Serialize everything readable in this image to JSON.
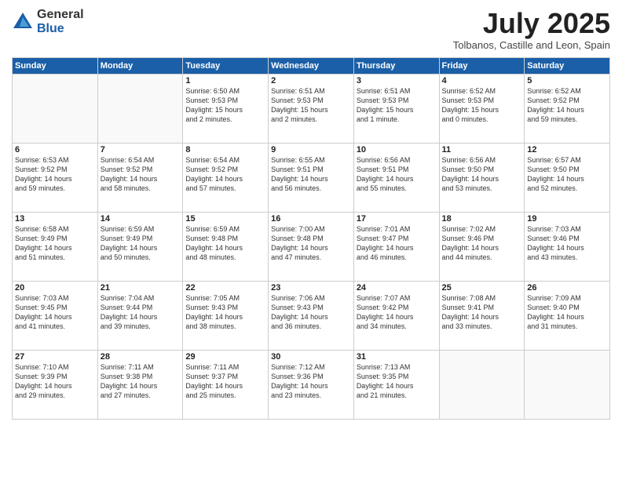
{
  "logo": {
    "general": "General",
    "blue": "Blue"
  },
  "title": "July 2025",
  "location": "Tolbanos, Castille and Leon, Spain",
  "weekdays": [
    "Sunday",
    "Monday",
    "Tuesday",
    "Wednesday",
    "Thursday",
    "Friday",
    "Saturday"
  ],
  "weeks": [
    [
      {
        "day": "",
        "info": ""
      },
      {
        "day": "",
        "info": ""
      },
      {
        "day": "1",
        "info": "Sunrise: 6:50 AM\nSunset: 9:53 PM\nDaylight: 15 hours\nand 2 minutes."
      },
      {
        "day": "2",
        "info": "Sunrise: 6:51 AM\nSunset: 9:53 PM\nDaylight: 15 hours\nand 2 minutes."
      },
      {
        "day": "3",
        "info": "Sunrise: 6:51 AM\nSunset: 9:53 PM\nDaylight: 15 hours\nand 1 minute."
      },
      {
        "day": "4",
        "info": "Sunrise: 6:52 AM\nSunset: 9:53 PM\nDaylight: 15 hours\nand 0 minutes."
      },
      {
        "day": "5",
        "info": "Sunrise: 6:52 AM\nSunset: 9:52 PM\nDaylight: 14 hours\nand 59 minutes."
      }
    ],
    [
      {
        "day": "6",
        "info": "Sunrise: 6:53 AM\nSunset: 9:52 PM\nDaylight: 14 hours\nand 59 minutes."
      },
      {
        "day": "7",
        "info": "Sunrise: 6:54 AM\nSunset: 9:52 PM\nDaylight: 14 hours\nand 58 minutes."
      },
      {
        "day": "8",
        "info": "Sunrise: 6:54 AM\nSunset: 9:52 PM\nDaylight: 14 hours\nand 57 minutes."
      },
      {
        "day": "9",
        "info": "Sunrise: 6:55 AM\nSunset: 9:51 PM\nDaylight: 14 hours\nand 56 minutes."
      },
      {
        "day": "10",
        "info": "Sunrise: 6:56 AM\nSunset: 9:51 PM\nDaylight: 14 hours\nand 55 minutes."
      },
      {
        "day": "11",
        "info": "Sunrise: 6:56 AM\nSunset: 9:50 PM\nDaylight: 14 hours\nand 53 minutes."
      },
      {
        "day": "12",
        "info": "Sunrise: 6:57 AM\nSunset: 9:50 PM\nDaylight: 14 hours\nand 52 minutes."
      }
    ],
    [
      {
        "day": "13",
        "info": "Sunrise: 6:58 AM\nSunset: 9:49 PM\nDaylight: 14 hours\nand 51 minutes."
      },
      {
        "day": "14",
        "info": "Sunrise: 6:59 AM\nSunset: 9:49 PM\nDaylight: 14 hours\nand 50 minutes."
      },
      {
        "day": "15",
        "info": "Sunrise: 6:59 AM\nSunset: 9:48 PM\nDaylight: 14 hours\nand 48 minutes."
      },
      {
        "day": "16",
        "info": "Sunrise: 7:00 AM\nSunset: 9:48 PM\nDaylight: 14 hours\nand 47 minutes."
      },
      {
        "day": "17",
        "info": "Sunrise: 7:01 AM\nSunset: 9:47 PM\nDaylight: 14 hours\nand 46 minutes."
      },
      {
        "day": "18",
        "info": "Sunrise: 7:02 AM\nSunset: 9:46 PM\nDaylight: 14 hours\nand 44 minutes."
      },
      {
        "day": "19",
        "info": "Sunrise: 7:03 AM\nSunset: 9:46 PM\nDaylight: 14 hours\nand 43 minutes."
      }
    ],
    [
      {
        "day": "20",
        "info": "Sunrise: 7:03 AM\nSunset: 9:45 PM\nDaylight: 14 hours\nand 41 minutes."
      },
      {
        "day": "21",
        "info": "Sunrise: 7:04 AM\nSunset: 9:44 PM\nDaylight: 14 hours\nand 39 minutes."
      },
      {
        "day": "22",
        "info": "Sunrise: 7:05 AM\nSunset: 9:43 PM\nDaylight: 14 hours\nand 38 minutes."
      },
      {
        "day": "23",
        "info": "Sunrise: 7:06 AM\nSunset: 9:43 PM\nDaylight: 14 hours\nand 36 minutes."
      },
      {
        "day": "24",
        "info": "Sunrise: 7:07 AM\nSunset: 9:42 PM\nDaylight: 14 hours\nand 34 minutes."
      },
      {
        "day": "25",
        "info": "Sunrise: 7:08 AM\nSunset: 9:41 PM\nDaylight: 14 hours\nand 33 minutes."
      },
      {
        "day": "26",
        "info": "Sunrise: 7:09 AM\nSunset: 9:40 PM\nDaylight: 14 hours\nand 31 minutes."
      }
    ],
    [
      {
        "day": "27",
        "info": "Sunrise: 7:10 AM\nSunset: 9:39 PM\nDaylight: 14 hours\nand 29 minutes."
      },
      {
        "day": "28",
        "info": "Sunrise: 7:11 AM\nSunset: 9:38 PM\nDaylight: 14 hours\nand 27 minutes."
      },
      {
        "day": "29",
        "info": "Sunrise: 7:11 AM\nSunset: 9:37 PM\nDaylight: 14 hours\nand 25 minutes."
      },
      {
        "day": "30",
        "info": "Sunrise: 7:12 AM\nSunset: 9:36 PM\nDaylight: 14 hours\nand 23 minutes."
      },
      {
        "day": "31",
        "info": "Sunrise: 7:13 AM\nSunset: 9:35 PM\nDaylight: 14 hours\nand 21 minutes."
      },
      {
        "day": "",
        "info": ""
      },
      {
        "day": "",
        "info": ""
      }
    ]
  ]
}
